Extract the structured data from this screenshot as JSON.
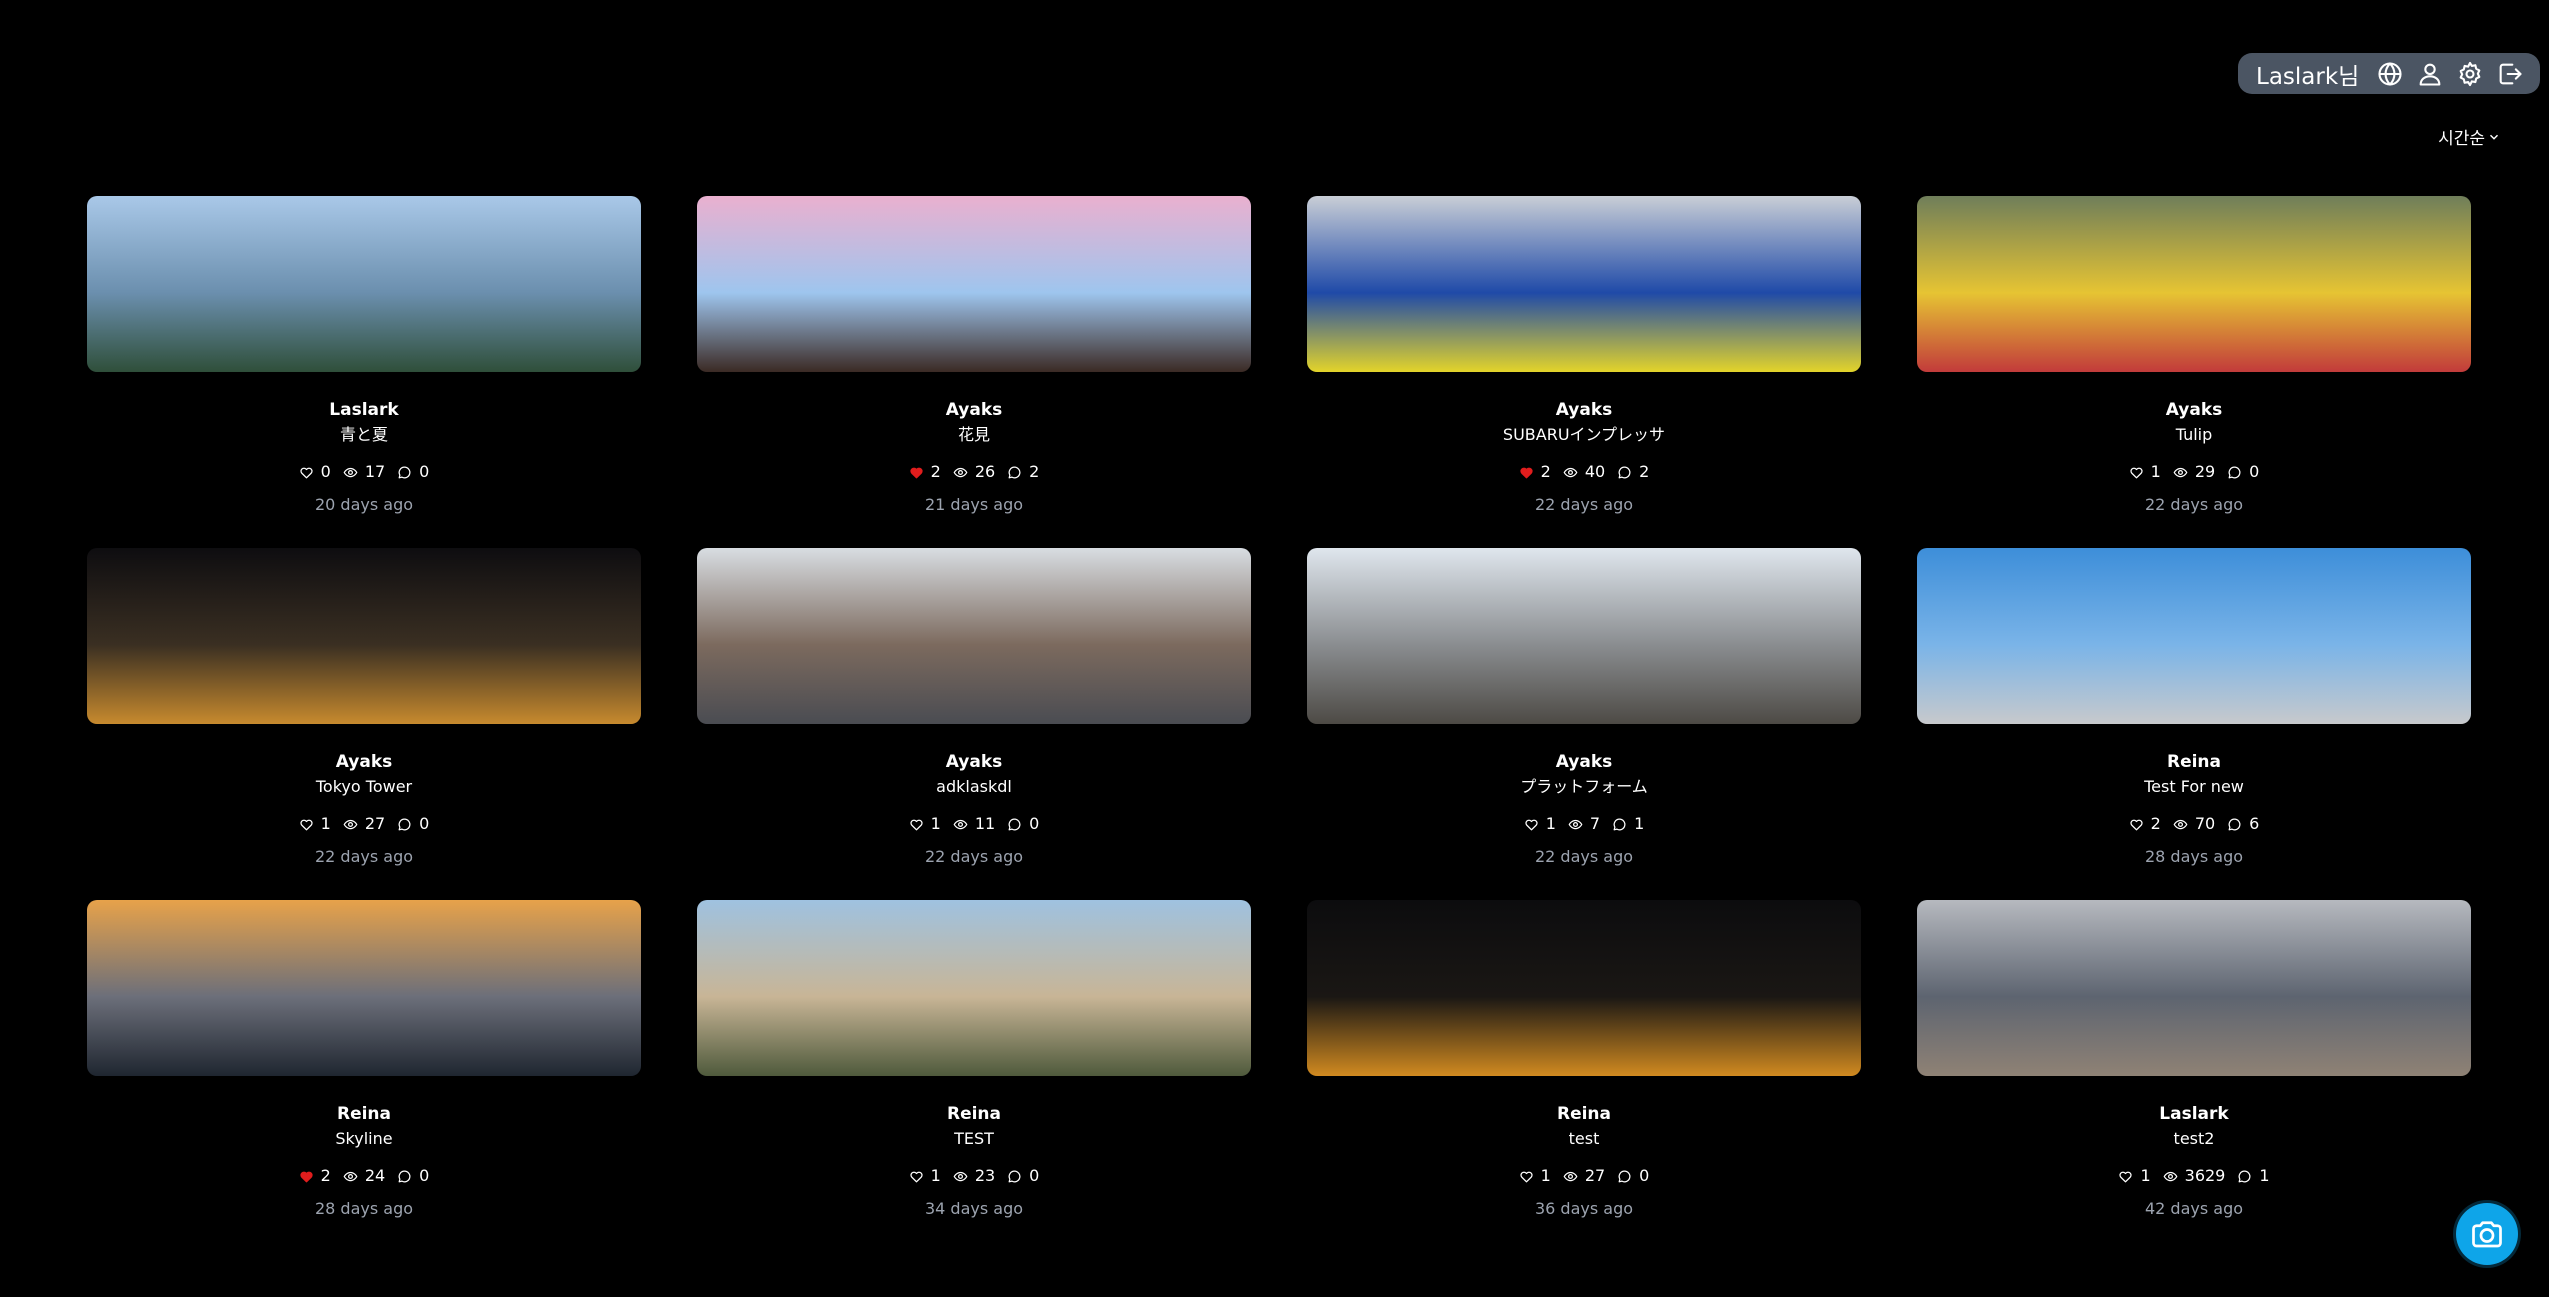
{
  "header": {
    "username": "Laslark님",
    "icons": [
      "globe-icon",
      "user-icon",
      "gear-icon",
      "logout-icon"
    ]
  },
  "sort": {
    "label": "시간순"
  },
  "posts": [
    {
      "author": "Laslark",
      "title": "青と夏",
      "likes": "0",
      "liked": false,
      "views": "17",
      "comments": "0",
      "date": "20 days ago",
      "thumb_colors": [
        "#a9c8e8",
        "#6b8fae",
        "#2f4f3a"
      ]
    },
    {
      "author": "Ayaks",
      "title": "花見",
      "likes": "2",
      "liked": true,
      "views": "26",
      "comments": "2",
      "date": "21 days ago",
      "thumb_colors": [
        "#eab0cf",
        "#9ec5ee",
        "#3b2a24"
      ]
    },
    {
      "author": "Ayaks",
      "title": "SUBARUインプレッサ",
      "likes": "2",
      "liked": true,
      "views": "40",
      "comments": "2",
      "date": "22 days ago",
      "thumb_colors": [
        "#c9ced6",
        "#1f4aa8",
        "#e3d42a"
      ]
    },
    {
      "author": "Ayaks",
      "title": "Tulip",
      "likes": "1",
      "liked": false,
      "views": "29",
      "comments": "0",
      "date": "22 days ago",
      "thumb_colors": [
        "#6f7e5a",
        "#e6c433",
        "#c23b3b"
      ]
    },
    {
      "author": "Ayaks",
      "title": "Tokyo Tower",
      "likes": "1",
      "liked": false,
      "views": "27",
      "comments": "0",
      "date": "22 days ago",
      "thumb_colors": [
        "#0e0d10",
        "#3a2f22",
        "#c78a2e"
      ]
    },
    {
      "author": "Ayaks",
      "title": "adklaskdl",
      "likes": "1",
      "liked": false,
      "views": "11",
      "comments": "0",
      "date": "22 days ago",
      "thumb_colors": [
        "#d8dde2",
        "#7c6a5e",
        "#4a4c52"
      ]
    },
    {
      "author": "Ayaks",
      "title": "プラットフォーム",
      "likes": "1",
      "liked": false,
      "views": "7",
      "comments": "1",
      "date": "22 days ago",
      "thumb_colors": [
        "#dfe6ed",
        "#8a8d90",
        "#4d4a45"
      ]
    },
    {
      "author": "Reina",
      "title": "Test For new",
      "likes": "2",
      "liked": false,
      "views": "70",
      "comments": "6",
      "date": "28 days ago",
      "thumb_colors": [
        "#3d8ed9",
        "#7ab4e8",
        "#c7c9cc"
      ]
    },
    {
      "author": "Reina",
      "title": "Skyline",
      "likes": "2",
      "liked": true,
      "views": "24",
      "comments": "0",
      "date": "28 days ago",
      "thumb_colors": [
        "#e7a24a",
        "#6c6f7a",
        "#1f2630"
      ]
    },
    {
      "author": "Reina",
      "title": "TEST",
      "likes": "1",
      "liked": false,
      "views": "23",
      "comments": "0",
      "date": "34 days ago",
      "thumb_colors": [
        "#9fc2e0",
        "#c8b596",
        "#4f5a3c"
      ]
    },
    {
      "author": "Reina",
      "title": "test",
      "likes": "1",
      "liked": false,
      "views": "27",
      "comments": "0",
      "date": "36 days ago",
      "thumb_colors": [
        "#0c0c0e",
        "#1a1714",
        "#d18a20"
      ]
    },
    {
      "author": "Laslark",
      "title": "test2",
      "likes": "1",
      "liked": false,
      "views": "3629",
      "comments": "1",
      "date": "42 days ago",
      "thumb_colors": [
        "#b6b9bf",
        "#5d6470",
        "#8f8275"
      ]
    }
  ],
  "fab": {
    "icon": "camera-icon"
  },
  "colors": {
    "background": "#000000",
    "pill": "#4b5563",
    "like": "#e11d1d",
    "fab": "#0ea5e9",
    "muted": "#9ca3af"
  }
}
